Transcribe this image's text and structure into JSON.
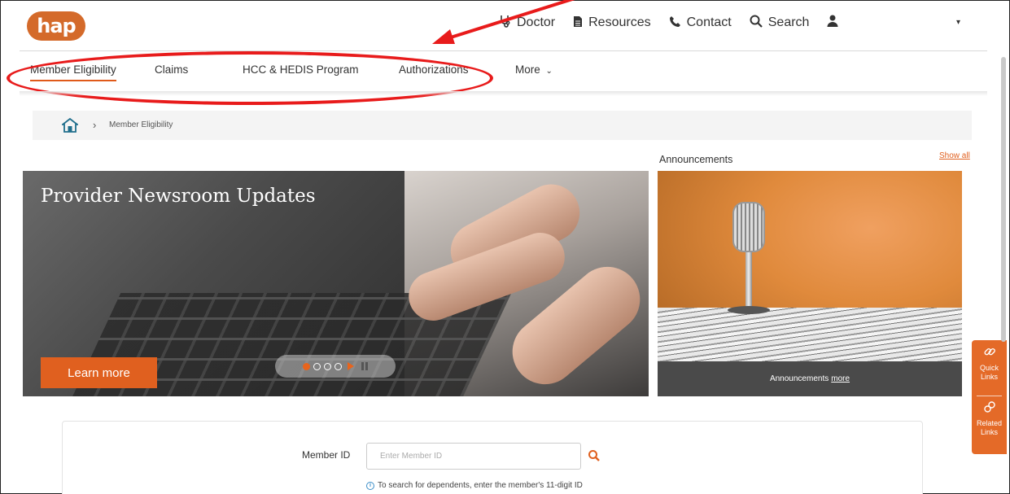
{
  "header": {
    "logo_text": "hap",
    "links": [
      {
        "icon": "stethoscope-icon",
        "label": "Doctor"
      },
      {
        "icon": "document-icon",
        "label": "Resources"
      },
      {
        "icon": "phone-icon",
        "label": "Contact"
      },
      {
        "icon": "search-icon",
        "label": "Search"
      }
    ]
  },
  "nav": {
    "items": [
      "Member Eligibility",
      "Claims",
      "HCC & HEDIS Program",
      "Authorizations"
    ],
    "more_label": "More",
    "active": "Member Eligibility"
  },
  "breadcrumb": {
    "current": "Member Eligibility"
  },
  "hero": {
    "title": "Provider Newsroom Updates",
    "button_label": "Learn more",
    "slide_count": 4,
    "active_slide": 1
  },
  "announcements": {
    "title": "Announcements",
    "show_all": "Show all",
    "footer_text": "Announcements",
    "footer_link": "more"
  },
  "member_search": {
    "label": "Member ID",
    "placeholder": "Enter Member ID",
    "hint": "To search for dependents, enter the member's 11-digit ID"
  },
  "side_tabs": [
    {
      "icon": "link-icon",
      "label_line1": "Quick",
      "label_line2": "Links"
    },
    {
      "icon": "chain-icon",
      "label_line1": "Related",
      "label_line2": "Links"
    }
  ],
  "colors": {
    "brand_orange": "#e0601f",
    "annotation_red": "#e81b1b"
  }
}
